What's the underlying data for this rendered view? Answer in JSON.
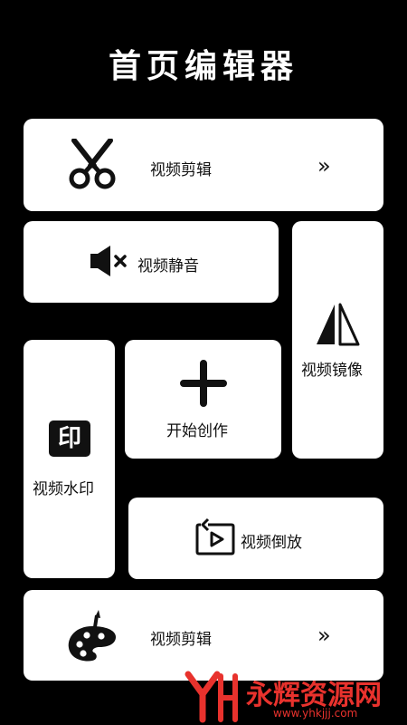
{
  "page": {
    "title": "首页编辑器"
  },
  "cards": {
    "video_cut_1": {
      "label": "视频剪辑",
      "icon": "scissors-icon",
      "arrow": "»"
    },
    "video_mute": {
      "label": "视频静音",
      "icon": "speaker-mute-icon"
    },
    "video_mirror": {
      "label": "视频镜像",
      "icon": "mirror-icon"
    },
    "start_create": {
      "label": "开始创作",
      "icon": "plus-icon"
    },
    "video_watermark": {
      "label": "视频水印",
      "icon": "stamp-icon",
      "icon_text": "印"
    },
    "video_reverse": {
      "label": "视频倒放",
      "icon": "reverse-play-icon"
    },
    "video_cut_2": {
      "label": "视频剪辑",
      "icon": "palette-brush-icon",
      "arrow": "»"
    }
  },
  "watermark": {
    "brand": "永辉资源网",
    "url": "www.yhkjjj.com"
  },
  "colors": {
    "background": "#000000",
    "card": "#ffffff",
    "watermark": "#e8322d"
  }
}
